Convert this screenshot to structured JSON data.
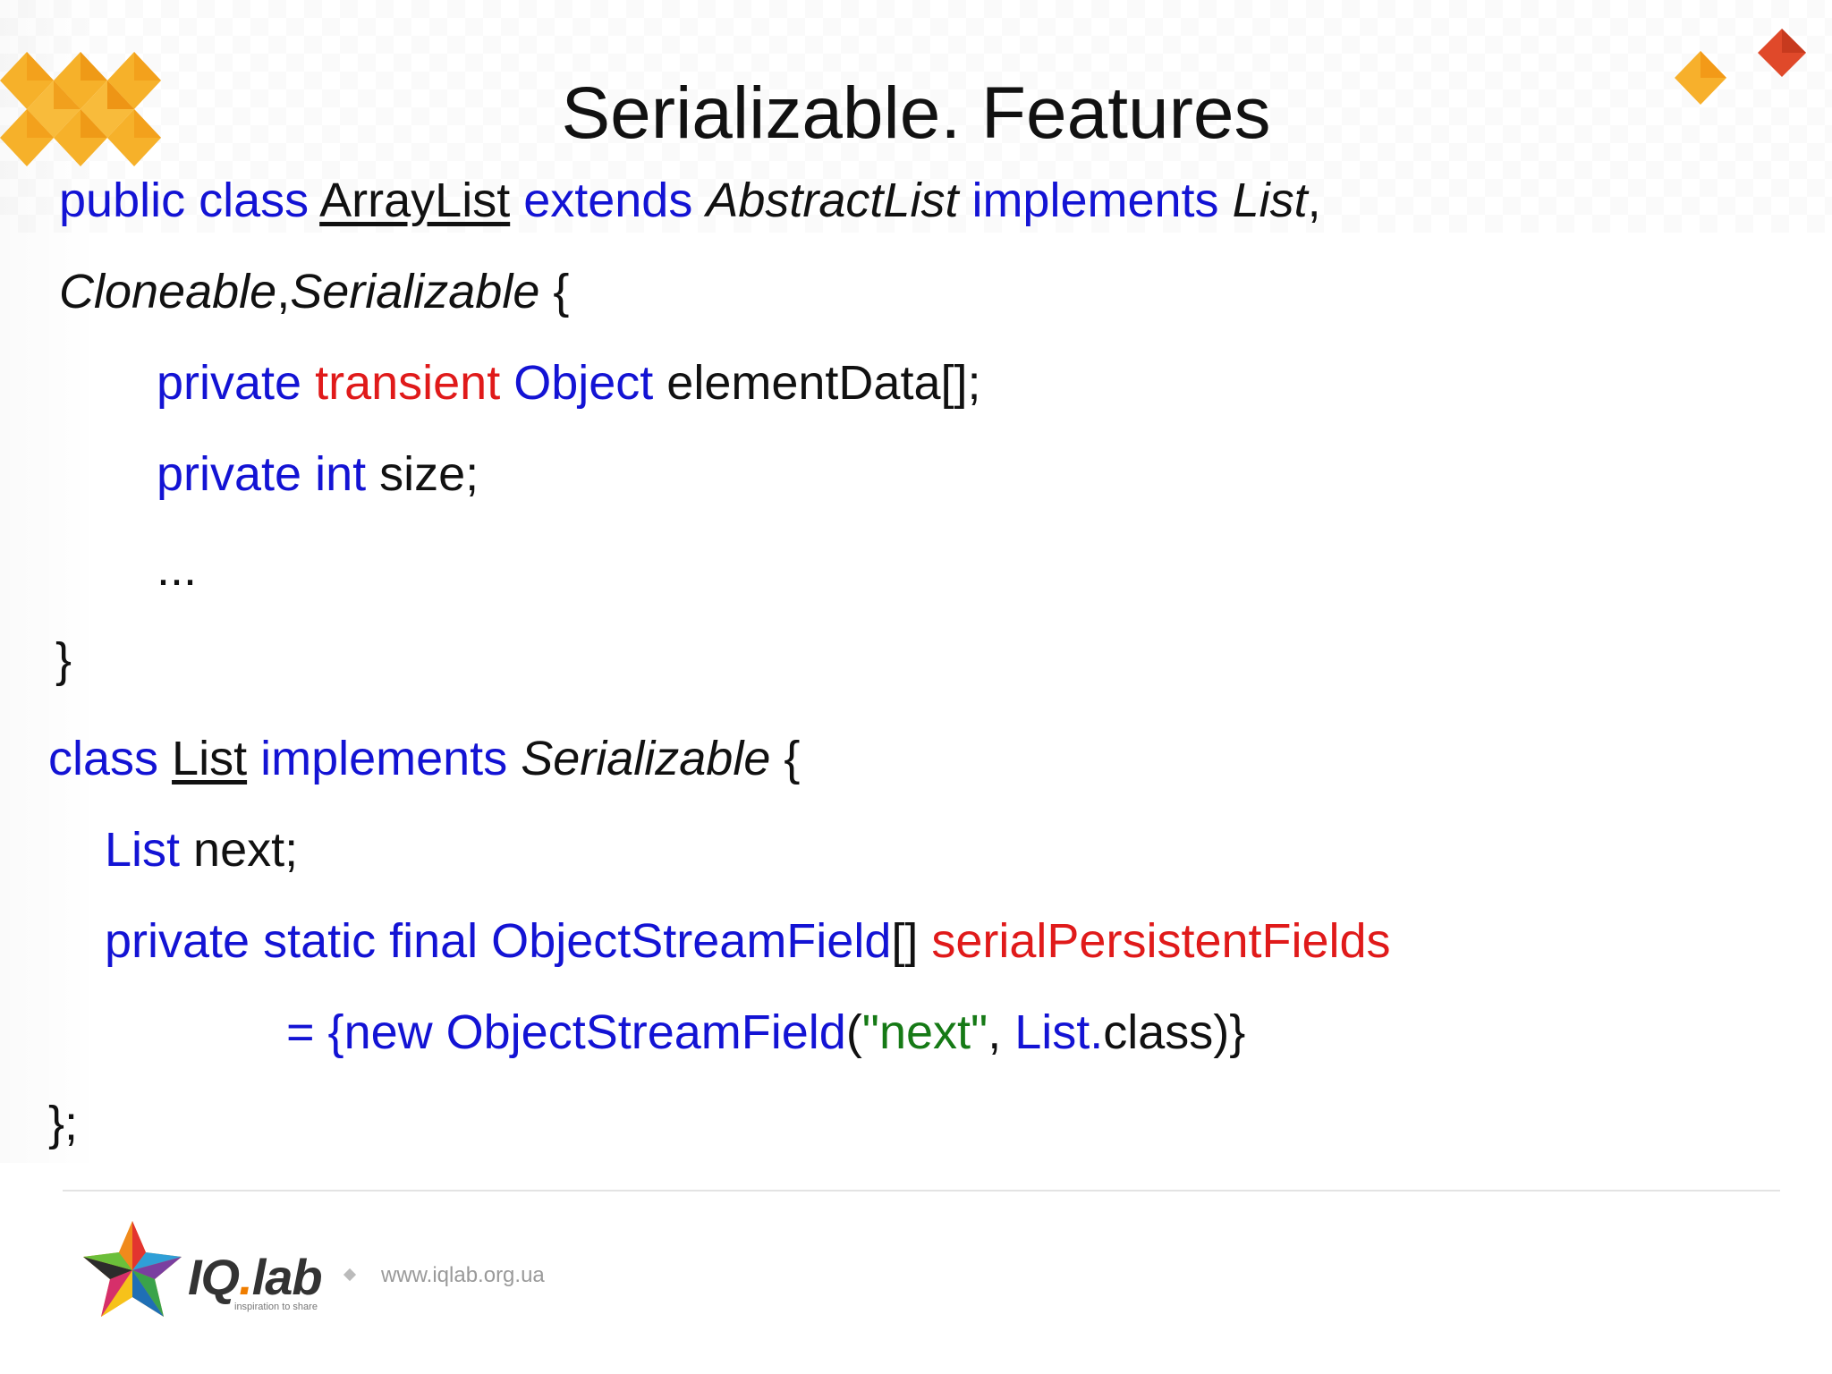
{
  "slide": {
    "title": "Serializable. Features"
  },
  "code": {
    "l1": {
      "public_class": "public class ",
      "arraylist": "ArrayList",
      "extends": " extends ",
      "abstractlist": "AbstractList",
      "implements": " implements ",
      "list": "List",
      "comma": ","
    },
    "l2": {
      "cloneable": "Cloneable",
      "comma": ",",
      "serializable": "Serializable",
      "brace": " {"
    },
    "l3": {
      "private": "private ",
      "transient": "transient",
      "object": " Object",
      "rest": " elementData[];"
    },
    "l4": {
      "private_int": "private int",
      "rest": " size;"
    },
    "l5": "...",
    "l6": "}",
    "l7": {
      "class": "class ",
      "list": "List",
      "implements": " implements ",
      "serializable": "Serializable",
      "brace": " {"
    },
    "l8": {
      "list": "List",
      "rest": " next;"
    },
    "l9": {
      "decl": "private static final ObjectStreamField",
      "brackets": "[] ",
      "name": "serialPersistentFields"
    },
    "l10": {
      "eq": "= {",
      "new": "new ObjectStreamField",
      "paren": "(",
      "str": "\"next\"",
      "comma": ", ",
      "list": "List.",
      "rest": "class)}"
    },
    "l11": "};"
  },
  "footer": {
    "brand_main": "IQ",
    "brand_dot": ".",
    "brand_lab": "lab",
    "tagline": "inspiration to share",
    "url": "www.iqlab.org.ua"
  },
  "colors": {
    "keyword": "#1313d4",
    "highlight": "#e01a1a",
    "string": "#167a16",
    "accent_orange": "#f4a21e"
  }
}
